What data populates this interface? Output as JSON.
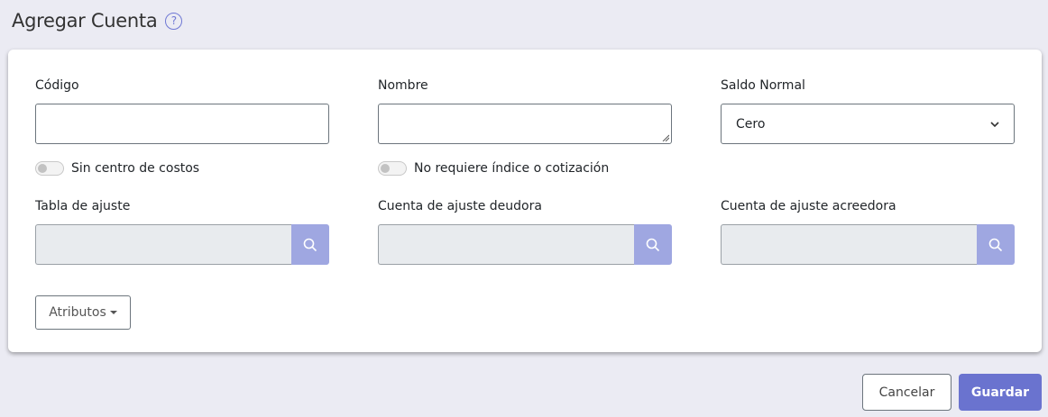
{
  "header": {
    "title": "Agregar Cuenta",
    "help_icon": "question-circle-icon"
  },
  "form": {
    "codigo": {
      "label": "Código",
      "value": ""
    },
    "nombre": {
      "label": "Nombre",
      "value": ""
    },
    "saldo_normal": {
      "label": "Saldo Normal",
      "value": "Cero"
    },
    "sin_centro_costos": {
      "label": "Sin centro de costos",
      "checked": false
    },
    "no_requiere_indice": {
      "label": "No requiere índice o cotización",
      "checked": false
    },
    "tabla_ajuste": {
      "label": "Tabla de ajuste",
      "value": ""
    },
    "cuenta_deudora": {
      "label": "Cuenta de ajuste deudora",
      "value": ""
    },
    "cuenta_acreedora": {
      "label": "Cuenta de ajuste acreedora",
      "value": ""
    },
    "atributos_label": "Atributos"
  },
  "footer": {
    "cancel_label": "Cancelar",
    "save_label": "Guardar"
  },
  "colors": {
    "accent": "#6a73cf",
    "lookup_button": "#9fa7e1",
    "background": "#ebebf3"
  }
}
